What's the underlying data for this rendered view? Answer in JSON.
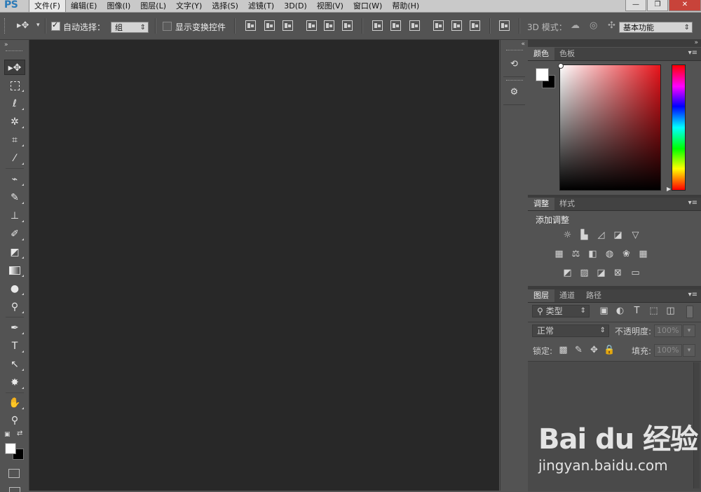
{
  "app": {
    "logo": "PS"
  },
  "menubar": {
    "items": [
      "文件(F)",
      "编辑(E)",
      "图像(I)",
      "图层(L)",
      "文字(Y)",
      "选择(S)",
      "滤镜(T)",
      "3D(D)",
      "视图(V)",
      "窗口(W)",
      "帮助(H)"
    ]
  },
  "window_controls": {
    "minimize": "—",
    "maximize": "❐",
    "close": "✕"
  },
  "optionsbar": {
    "auto_select_label": "自动选择：",
    "auto_select_value": "组",
    "show_transform_label": "显示变换控件",
    "mode_3d_label": "3D 模式：",
    "workspace_value": "基本功能"
  },
  "toolbox": {
    "tools": [
      "move-tool",
      "marquee-tool",
      "lasso-tool",
      "magic-wand-tool",
      "crop-tool",
      "eyedropper-tool",
      "healing-brush-tool",
      "brush-tool",
      "clone-stamp-tool",
      "history-brush-tool",
      "eraser-tool",
      "gradient-tool",
      "blur-tool",
      "dodge-tool",
      "pen-tool",
      "type-tool",
      "path-selection-tool",
      "shape-tool",
      "hand-tool",
      "zoom-tool"
    ],
    "type_tool_glyph": "T"
  },
  "panels": {
    "color": {
      "tabs": [
        "颜色",
        "色板"
      ]
    },
    "adjustments": {
      "tabs": [
        "调整",
        "样式"
      ],
      "title": "添加调整"
    },
    "layers": {
      "tabs": [
        "图层",
        "通道",
        "路径"
      ],
      "filter_value": "类型",
      "blend_mode": "正常",
      "opacity_label": "不透明度:",
      "opacity_value": "100%",
      "lock_label": "锁定:",
      "fill_label": "填充:",
      "fill_value": "100%"
    }
  },
  "watermark": {
    "logo": "Bai du 经验",
    "url": "jingyan.baidu.com"
  },
  "colors": {
    "foreground": "#ffffff",
    "background": "#000000",
    "canvas": "#282828",
    "accent": "#2a7ab8"
  }
}
